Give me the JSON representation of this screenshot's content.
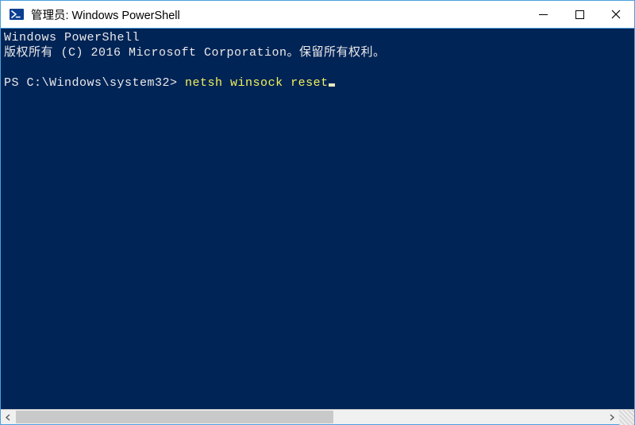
{
  "window": {
    "title": "管理员: Windows PowerShell"
  },
  "terminal": {
    "line1": "Windows PowerShell",
    "line2": "版权所有 (C) 2016 Microsoft Corporation。保留所有权利。",
    "prompt": "PS C:\\Windows\\system32> ",
    "command": "netsh winsock reset"
  }
}
